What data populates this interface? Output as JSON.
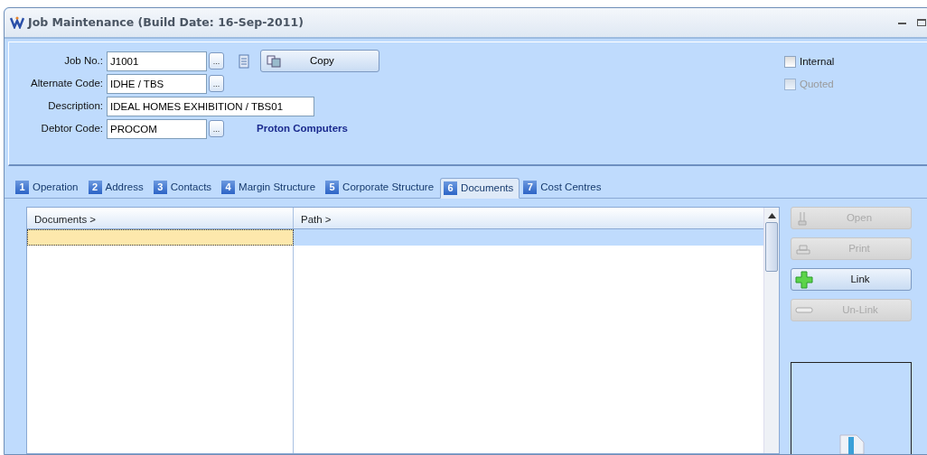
{
  "window": {
    "title": "Job Maintenance (Build Date: 16-Sep-2011)"
  },
  "header": {
    "fields": [
      {
        "label": "Job No.:",
        "value": "J1001",
        "lookup": true,
        "kind": "code"
      },
      {
        "label": "Alternate Code:",
        "value": "IDHE / TBS",
        "lookup": true,
        "kind": "code"
      },
      {
        "label": "Description:",
        "value": "IDEAL HOMES EXHIBITION / TBS01",
        "lookup": false,
        "kind": "wide"
      },
      {
        "label": "Debtor Code:",
        "value": "PROCOM",
        "lookup": true,
        "kind": "code",
        "note": "Proton Computers"
      }
    ],
    "lookup_label": "...",
    "copy_button": "Copy",
    "checkboxes": [
      {
        "label": "Internal",
        "checked": false,
        "disabled": false
      },
      {
        "label": "Quoted",
        "checked": false,
        "disabled": true
      }
    ]
  },
  "tabs": [
    {
      "number": "1",
      "label": "Operation",
      "selected": false
    },
    {
      "number": "2",
      "label": "Address",
      "selected": false
    },
    {
      "number": "3",
      "label": "Contacts",
      "selected": false
    },
    {
      "number": "4",
      "label": "Margin Structure",
      "selected": false
    },
    {
      "number": "5",
      "label": "Corporate Structure",
      "selected": false
    },
    {
      "number": "6",
      "label": "Documents",
      "selected": true
    },
    {
      "number": "7",
      "label": "Cost Centres",
      "selected": false
    }
  ],
  "table": {
    "columns": [
      "Documents >",
      "Path >"
    ],
    "rows": [
      {
        "selected": true
      }
    ]
  },
  "actions": [
    {
      "label": "Open",
      "kind": "open",
      "disabled": true
    },
    {
      "label": "Print",
      "kind": "print",
      "disabled": true
    },
    {
      "label": "Link",
      "kind": "link",
      "disabled": false
    },
    {
      "label": "Un-Link",
      "kind": "unlink",
      "disabled": true
    }
  ]
}
